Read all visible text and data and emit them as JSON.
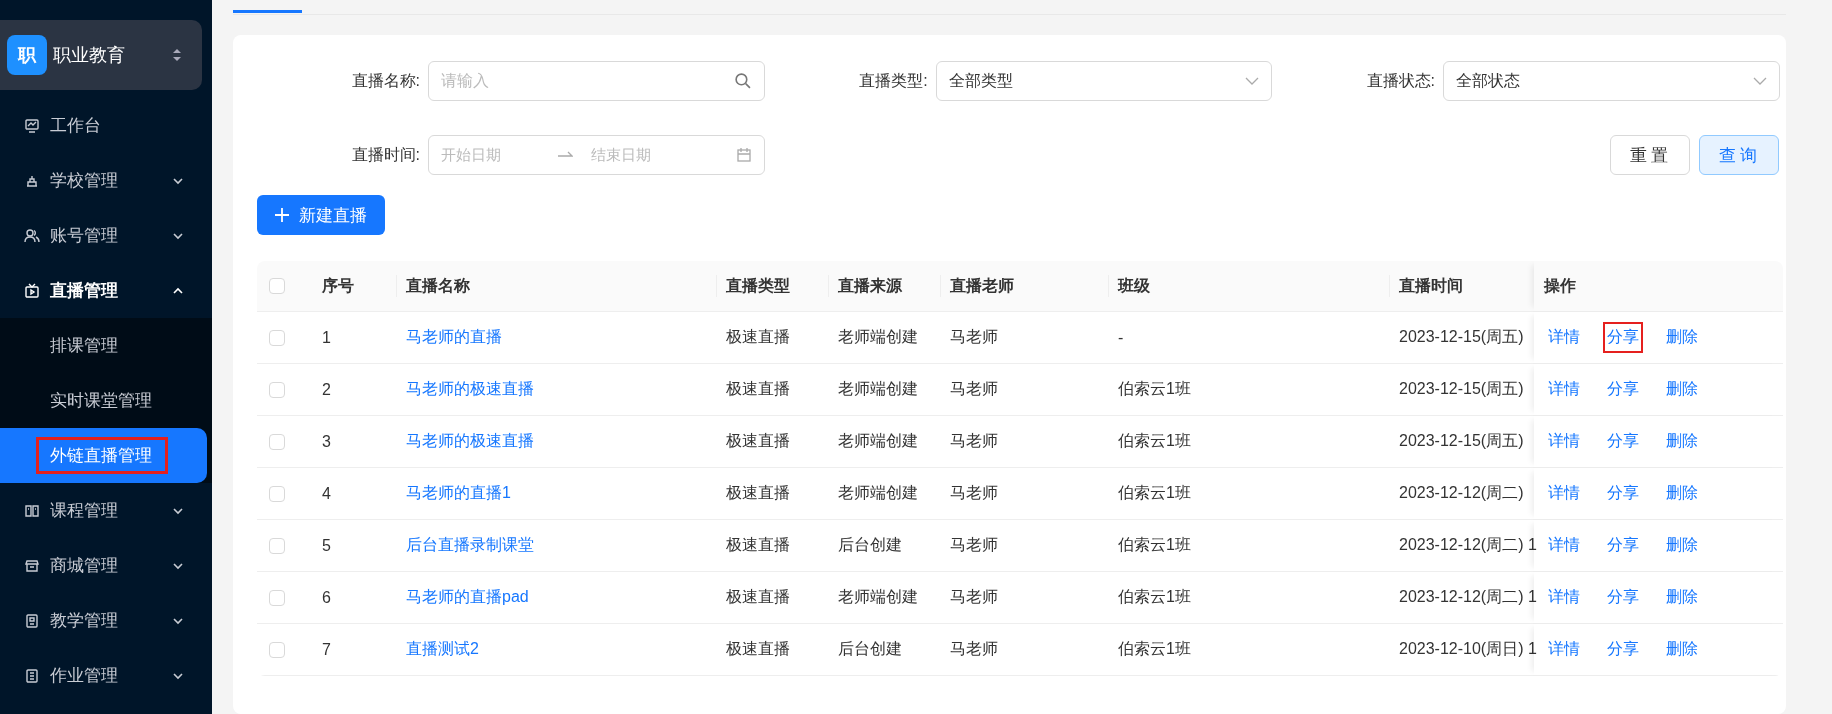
{
  "org_switcher": {
    "badge": "职",
    "name": "职业教育"
  },
  "sidebar": {
    "items": [
      {
        "label": "工作台",
        "kind": "link"
      },
      {
        "label": "学校管理",
        "kind": "group",
        "expanded": false
      },
      {
        "label": "账号管理",
        "kind": "group",
        "expanded": false
      },
      {
        "label": "直播管理",
        "kind": "group",
        "expanded": true,
        "children": [
          {
            "label": "排课管理",
            "selected": false,
            "highlighted": false
          },
          {
            "label": "实时课堂管理",
            "selected": false,
            "highlighted": false
          },
          {
            "label": "外链直播管理",
            "selected": true,
            "highlighted": true
          }
        ]
      },
      {
        "label": "课程管理",
        "kind": "group",
        "expanded": false
      },
      {
        "label": "商城管理",
        "kind": "group",
        "expanded": false
      },
      {
        "label": "教学管理",
        "kind": "group",
        "expanded": false
      },
      {
        "label": "作业管理",
        "kind": "group",
        "expanded": false
      }
    ]
  },
  "filters": [
    {
      "kind": "text",
      "label": "直播名称:",
      "placeholder": "请输入"
    },
    {
      "kind": "select",
      "label": "直播类型:",
      "value": "全部类型"
    },
    {
      "kind": "select",
      "label": "直播状态:",
      "value": "全部状态"
    },
    {
      "kind": "daterange",
      "label": "直播时间:",
      "start_placeholder": "开始日期",
      "end_placeholder": "结束日期"
    }
  ],
  "filter_buttons": [
    {
      "label": "重置",
      "kind": "default"
    },
    {
      "label": "查询",
      "kind": "primary"
    }
  ],
  "create_button": "新建直播",
  "table": {
    "select_all": false,
    "columns": [
      "序号",
      "直播名称",
      "直播类型",
      "直播来源",
      "直播老师",
      "班级",
      "直播时间",
      "操作"
    ],
    "rows": [
      {
        "selected": false,
        "cells": [
          "1",
          "马老师的直播",
          "极速直播",
          "老师端创建",
          "马老师",
          "-",
          "2023-12-15(周五)"
        ],
        "actions": [
          {
            "label": "详情",
            "highlighted": false
          },
          {
            "label": "分享",
            "highlighted": true
          },
          {
            "label": "删除",
            "highlighted": false
          }
        ]
      },
      {
        "selected": false,
        "cells": [
          "2",
          "马老师的极速直播",
          "极速直播",
          "老师端创建",
          "马老师",
          "伯索云1班",
          "2023-12-15(周五)"
        ],
        "actions": [
          {
            "label": "详情",
            "highlighted": false
          },
          {
            "label": "分享",
            "highlighted": false
          },
          {
            "label": "删除",
            "highlighted": false
          }
        ]
      },
      {
        "selected": false,
        "cells": [
          "3",
          "马老师的极速直播",
          "极速直播",
          "老师端创建",
          "马老师",
          "伯索云1班",
          "2023-12-15(周五)"
        ],
        "actions": [
          {
            "label": "详情",
            "highlighted": false
          },
          {
            "label": "分享",
            "highlighted": false
          },
          {
            "label": "删除",
            "highlighted": false
          }
        ]
      },
      {
        "selected": false,
        "cells": [
          "4",
          "马老师的直播1",
          "极速直播",
          "老师端创建",
          "马老师",
          "伯索云1班",
          "2023-12-12(周二)"
        ],
        "actions": [
          {
            "label": "详情",
            "highlighted": false
          },
          {
            "label": "分享",
            "highlighted": false
          },
          {
            "label": "删除",
            "highlighted": false
          }
        ]
      },
      {
        "selected": false,
        "cells": [
          "5",
          "后台直播录制课堂",
          "极速直播",
          "后台创建",
          "马老师",
          "伯索云1班",
          "2023-12-12(周二) 1"
        ],
        "actions": [
          {
            "label": "详情",
            "highlighted": false
          },
          {
            "label": "分享",
            "highlighted": false
          },
          {
            "label": "删除",
            "highlighted": false
          }
        ]
      },
      {
        "selected": false,
        "cells": [
          "6",
          "马老师的直播pad",
          "极速直播",
          "老师端创建",
          "马老师",
          "伯索云1班",
          "2023-12-12(周二) 1"
        ],
        "actions": [
          {
            "label": "详情",
            "highlighted": false
          },
          {
            "label": "分享",
            "highlighted": false
          },
          {
            "label": "删除",
            "highlighted": false
          }
        ]
      },
      {
        "selected": false,
        "cells": [
          "7",
          "直播测试2",
          "极速直播",
          "后台创建",
          "马老师",
          "伯索云1班",
          "2023-12-10(周日) 1"
        ],
        "actions": [
          {
            "label": "详情",
            "highlighted": false
          },
          {
            "label": "分享",
            "highlighted": false
          },
          {
            "label": "删除",
            "highlighted": false
          }
        ]
      }
    ]
  }
}
